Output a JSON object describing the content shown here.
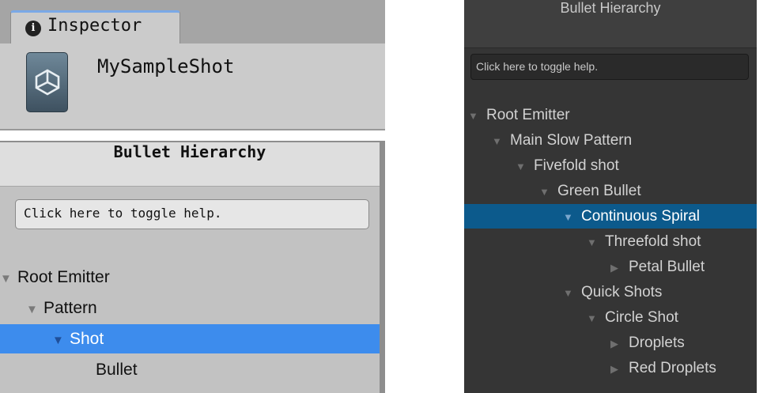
{
  "light_inspector": {
    "tab_label": "Inspector",
    "info_glyph": "i",
    "asset_name": "MySampleShot",
    "panel_title": "Bullet Hierarchy",
    "help_text": "Click here to toggle help.",
    "tree": [
      {
        "label": "Root Emitter",
        "arrow": "▼",
        "depth": 0,
        "selected": false
      },
      {
        "label": "Pattern",
        "arrow": "▼",
        "depth": 1,
        "selected": false
      },
      {
        "label": "Shot",
        "arrow": "▼",
        "depth": 2,
        "selected": true
      },
      {
        "label": "Bullet",
        "arrow": "",
        "depth": 3,
        "selected": false
      }
    ]
  },
  "dark_hierarchy": {
    "panel_title": "Bullet Hierarchy",
    "help_text": "Click here to toggle help.",
    "tree": [
      {
        "label": "Root Emitter",
        "arrow": "▼",
        "depth": 0,
        "selected": false
      },
      {
        "label": "Main Slow Pattern",
        "arrow": "▼",
        "depth": 1,
        "selected": false
      },
      {
        "label": "Fivefold shot",
        "arrow": "▼",
        "depth": 2,
        "selected": false
      },
      {
        "label": "Green Bullet",
        "arrow": "▼",
        "depth": 3,
        "selected": false
      },
      {
        "label": "Continuous Spiral",
        "arrow": "▼",
        "depth": 4,
        "selected": true
      },
      {
        "label": "Threefold shot",
        "arrow": "▼",
        "depth": 5,
        "selected": false
      },
      {
        "label": "Petal Bullet",
        "arrow": "▶",
        "depth": 6,
        "selected": false
      },
      {
        "label": "Quick Shots",
        "arrow": "▼",
        "depth": 4,
        "selected": false
      },
      {
        "label": "Circle Shot",
        "arrow": "▼",
        "depth": 5,
        "selected": false
      },
      {
        "label": "Droplets",
        "arrow": "▶",
        "depth": 6,
        "selected": false
      },
      {
        "label": "Red Droplets",
        "arrow": "▶",
        "depth": 6,
        "selected": false
      }
    ]
  },
  "colors": {
    "selection_light": "#3d8ced",
    "selection_dark": "#0c5a8c",
    "dark_background": "#353535"
  }
}
